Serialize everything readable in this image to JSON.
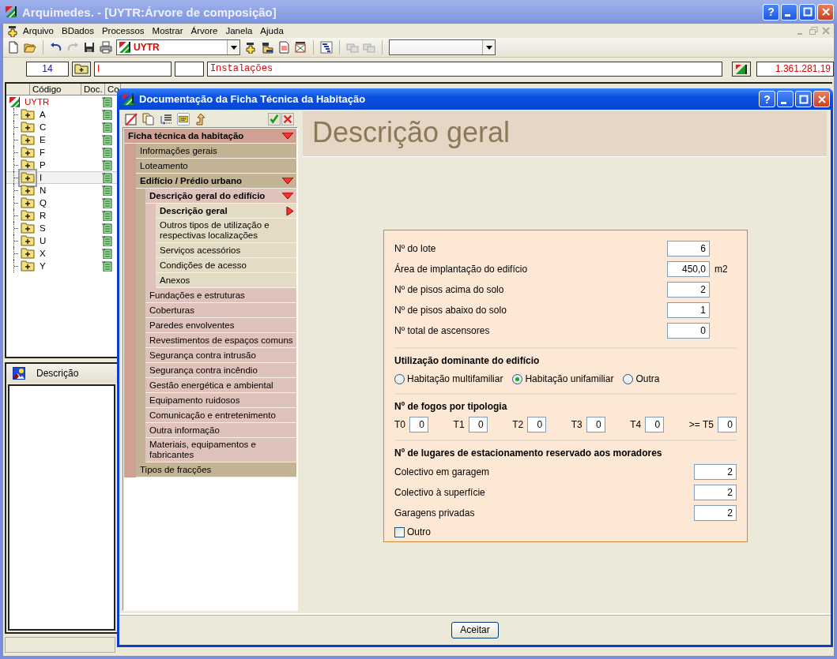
{
  "main_window": {
    "title": "Arquimedes. - [UYTR:Árvore de composição]",
    "help_button": "?",
    "menu": [
      "Arquivo",
      "BDados",
      "Processos",
      "Mostrar",
      "Árvore",
      "Janela",
      "Ajuda"
    ],
    "project_combo": "UYTR",
    "fields": {
      "count": "14",
      "code": "I",
      "summary": "Instalações",
      "total": "1.361.281,19"
    },
    "tree": {
      "columns": [
        "Código",
        "Doc.",
        "Co"
      ],
      "root": "UYTR",
      "items": [
        {
          "label": "A",
          "selected": false
        },
        {
          "label": "C",
          "selected": false
        },
        {
          "label": "E",
          "selected": false
        },
        {
          "label": "F",
          "selected": false
        },
        {
          "label": "P",
          "selected": false
        },
        {
          "label": "I",
          "selected": true
        },
        {
          "label": "N",
          "selected": false
        },
        {
          "label": "Q",
          "selected": false
        },
        {
          "label": "R",
          "selected": false
        },
        {
          "label": "S",
          "selected": false
        },
        {
          "label": "U",
          "selected": false
        },
        {
          "label": "X",
          "selected": false
        },
        {
          "label": "Y",
          "selected": false
        }
      ]
    },
    "description_panel": {
      "title": "Descrição"
    }
  },
  "dialog": {
    "title": "Documentação da Ficha Técnica da Habitação",
    "help_button": "?",
    "nav": [
      {
        "label": "Ficha técnica da habitação",
        "selected": false,
        "expanded": true,
        "children": [
          {
            "label": "Informações gerais",
            "selected": false
          },
          {
            "label": "Loteamento",
            "selected": false
          },
          {
            "label": "Edifício / Prédio urbano",
            "selected": false,
            "expanded": true,
            "children": [
              {
                "label": "Descrição geral do edifício",
                "selected": false,
                "expanded": true,
                "children": [
                  {
                    "label": "Descrição geral",
                    "selected": true
                  },
                  {
                    "label": "Outros tipos de utilização e respectivas localizações",
                    "selected": false
                  },
                  {
                    "label": "Serviços acessórios",
                    "selected": false
                  },
                  {
                    "label": "Condições de acesso",
                    "selected": false
                  },
                  {
                    "label": "Anexos",
                    "selected": false
                  }
                ]
              },
              {
                "label": "Fundações e estruturas",
                "selected": false
              },
              {
                "label": "Coberturas",
                "selected": false
              },
              {
                "label": "Paredes envolventes",
                "selected": false
              },
              {
                "label": "Revestimentos de espaços comuns",
                "selected": false
              },
              {
                "label": "Segurança contra intrusão",
                "selected": false
              },
              {
                "label": "Segurança contra incêndio",
                "selected": false
              },
              {
                "label": "Gestão energética e ambiental",
                "selected": false
              },
              {
                "label": "Equipamento ruidosos",
                "selected": false
              },
              {
                "label": "Comunicação e entretenimento",
                "selected": false
              },
              {
                "label": "Outra informação",
                "selected": false
              },
              {
                "label": "Materiais, equipamentos e fabricantes",
                "selected": false
              }
            ]
          },
          {
            "label": "Tipos de fracções",
            "selected": false
          }
        ]
      }
    ],
    "heading": "Descrição geral",
    "form": {
      "fields": [
        {
          "label": "Nº do lote",
          "value": "6"
        },
        {
          "label": "Área de implantação do edifício",
          "value": "450,0",
          "unit": "m2"
        },
        {
          "label": "Nº de pisos acima do solo",
          "value": "2"
        },
        {
          "label": "Nº de pisos abaixo do solo",
          "value": "1"
        },
        {
          "label": "Nº total de ascensores",
          "value": "0"
        }
      ],
      "usage": {
        "title": "Utilização dominante do edifício",
        "options": [
          {
            "label": "Habitação multifamiliar",
            "selected": false
          },
          {
            "label": "Habitação unifamiliar",
            "selected": true
          },
          {
            "label": "Outra",
            "selected": false
          }
        ]
      },
      "typologies": {
        "title": "Nº de fogos por tipologia",
        "items": [
          {
            "label": "T0",
            "value": "0"
          },
          {
            "label": "T1",
            "value": "0"
          },
          {
            "label": "T2",
            "value": "0"
          },
          {
            "label": "T3",
            "value": "0"
          },
          {
            "label": "T4",
            "value": "0"
          },
          {
            "label": ">= T5",
            "value": "0"
          }
        ]
      },
      "parking": {
        "title": "Nº de lugares de estacionamento reservado aos moradores",
        "fields": [
          {
            "label": "Colectivo em garagem",
            "value": "2"
          },
          {
            "label": "Colectivo à superfície",
            "value": "2"
          },
          {
            "label": "Garagens privadas",
            "value": "2"
          }
        ],
        "other": {
          "label": "Outro",
          "checked": false
        }
      }
    },
    "accept_button": "Aceitar"
  }
}
